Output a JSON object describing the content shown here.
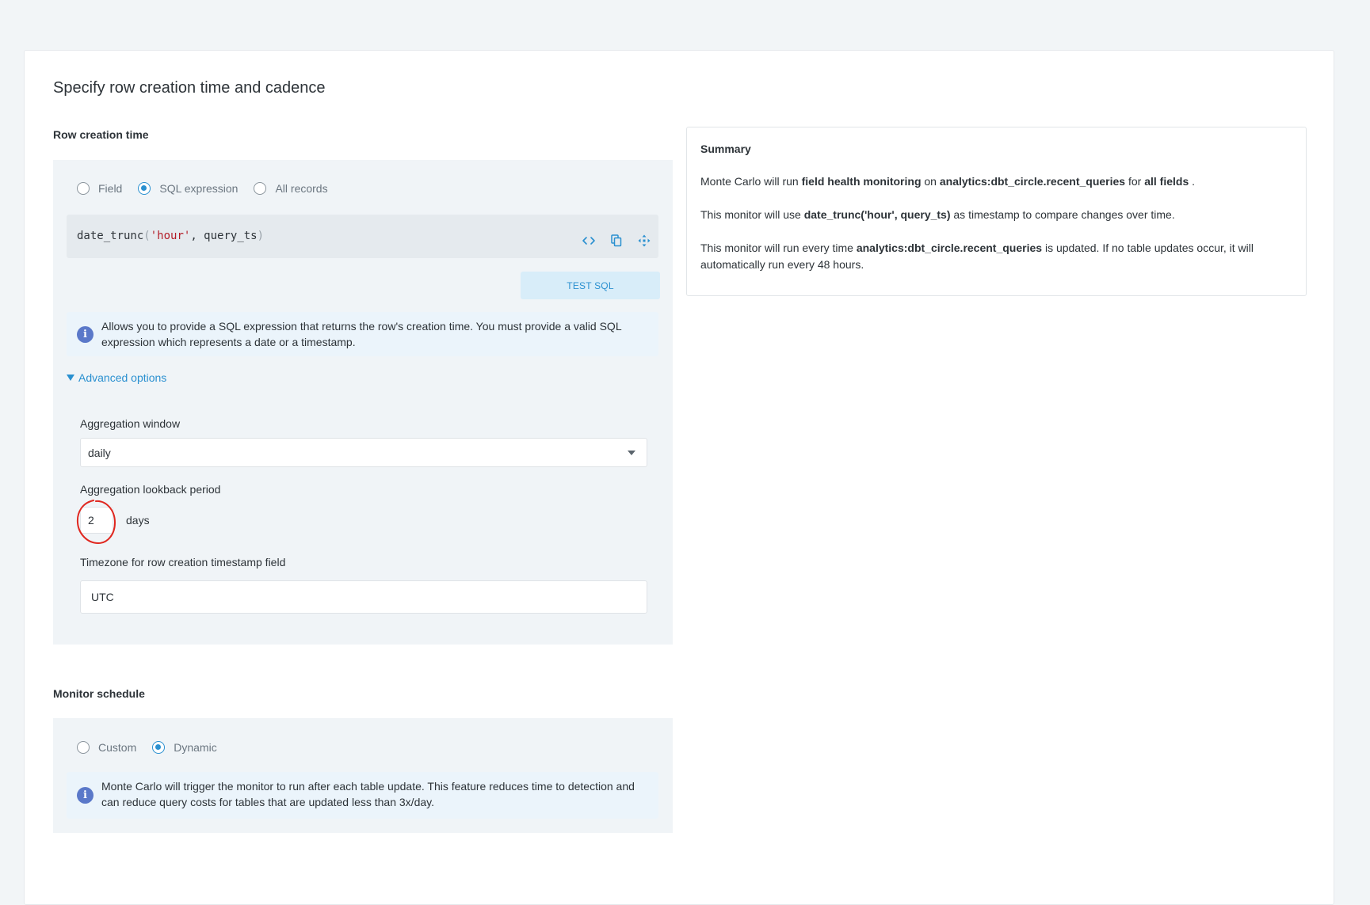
{
  "page": {
    "title": "Specify row creation time and cadence"
  },
  "row_creation": {
    "label": "Row creation time",
    "options": [
      {
        "label": "Field",
        "checked": false
      },
      {
        "label": "SQL expression",
        "checked": true
      },
      {
        "label": "All records",
        "checked": false
      }
    ],
    "code": {
      "fn": "date_trunc",
      "open_paren": "(",
      "arg_string": "'hour'",
      "rest": ", query_ts",
      "close_paren": ")"
    },
    "icons": [
      "code-icon",
      "copy-icon",
      "expand-icon"
    ],
    "test_sql_label": "TEST SQL",
    "info": "Allows you to provide a SQL expression that returns the row's creation time. You must provide a valid SQL expression which represents a date or a timestamp.",
    "advanced_label": "Advanced options",
    "aggregation_window_label": "Aggregation window",
    "aggregation_window_value": "daily",
    "lookback_label": "Aggregation lookback period",
    "lookback_value": "2",
    "lookback_unit": "days",
    "timezone_label": "Timezone for row creation timestamp field",
    "timezone_value": "UTC"
  },
  "schedule": {
    "label": "Monitor schedule",
    "options": [
      {
        "label": "Custom",
        "checked": false
      },
      {
        "label": "Dynamic",
        "checked": true
      }
    ],
    "info": "Monte Carlo will trigger the monitor to run after each table update. This feature reduces time to detection and can reduce query costs for tables that are updated less than 3x/day."
  },
  "summary": {
    "title": "Summary",
    "line1": {
      "t1": "Monte Carlo will run ",
      "b1": "field health monitoring",
      "t2": " on ",
      "b2": "analytics:dbt_circle.recent_queries",
      "t3": " for ",
      "b3": "all fields",
      "t4": " ."
    },
    "line2": {
      "t1": "This monitor will use ",
      "b1": "date_trunc('hour', query_ts)",
      "t2": " as timestamp to compare changes over time."
    },
    "line3": {
      "t1": "This monitor will run every time ",
      "b1": "analytics:dbt_circle.recent_queries",
      "t2": " is updated. If no table updates occur, it will automatically run every 48 hours."
    }
  },
  "colors": {
    "accent": "#2a90d0",
    "annotation": "#e0271f",
    "info_icon": "#5a78c9"
  }
}
